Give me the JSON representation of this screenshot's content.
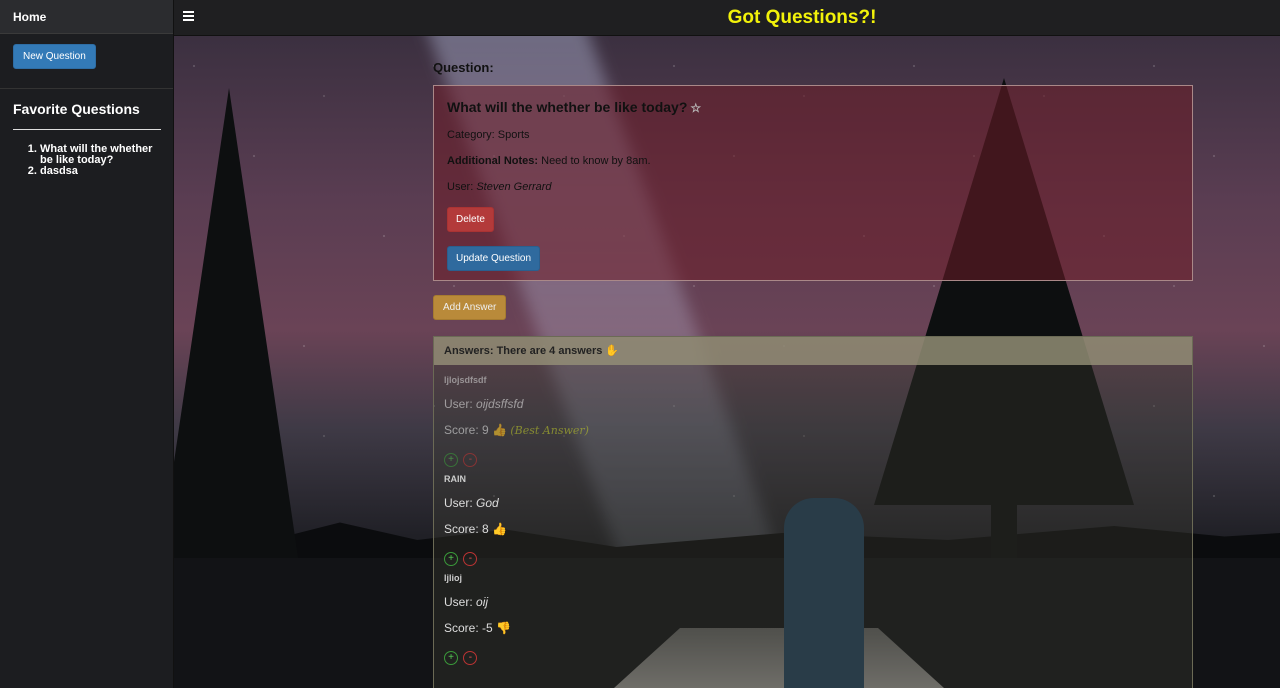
{
  "sidebar": {
    "home_label": "Home",
    "new_question_label": "New Question",
    "favorites_title": "Favorite Questions",
    "favorites": [
      "What will the whether be like today?",
      "dasdsa"
    ]
  },
  "topbar": {
    "title": "Got Questions?!",
    "title_color": "#f2f20a"
  },
  "question": {
    "heading": "Question:",
    "title": "What will the whether be like today?",
    "favorite_icon": "star-outline-icon",
    "category_label": "Category:",
    "category": "Sports",
    "notes_label": "Additional Notes:",
    "notes": "Need to know by 8am.",
    "user_label": "User:",
    "user": "Steven Gerrard",
    "delete_label": "Delete",
    "update_label": "Update Question"
  },
  "add_answer_label": "Add Answer",
  "answers": {
    "header": "Answers: There are 4 answers",
    "header_icon": "hand-icon",
    "items": [
      {
        "title": "ljlojsdfsdf",
        "user_label": "User:",
        "user": "oijdsffsfd",
        "score_label": "Score:",
        "score": "9",
        "score_icon": "thumbs-up-icon",
        "best": "(Best Answer)",
        "up": "+",
        "down": "-"
      },
      {
        "title": "RAIN",
        "user_label": "User:",
        "user": "God",
        "score_label": "Score:",
        "score": "8",
        "score_icon": "thumbs-up-icon",
        "best": "",
        "up": "+",
        "down": "-"
      },
      {
        "title": "ljlioj",
        "user_label": "User:",
        "user": "oij",
        "score_label": "Score:",
        "score": "-5",
        "score_icon": "thumbs-down-icon",
        "best": "",
        "up": "+",
        "down": "-"
      }
    ]
  }
}
